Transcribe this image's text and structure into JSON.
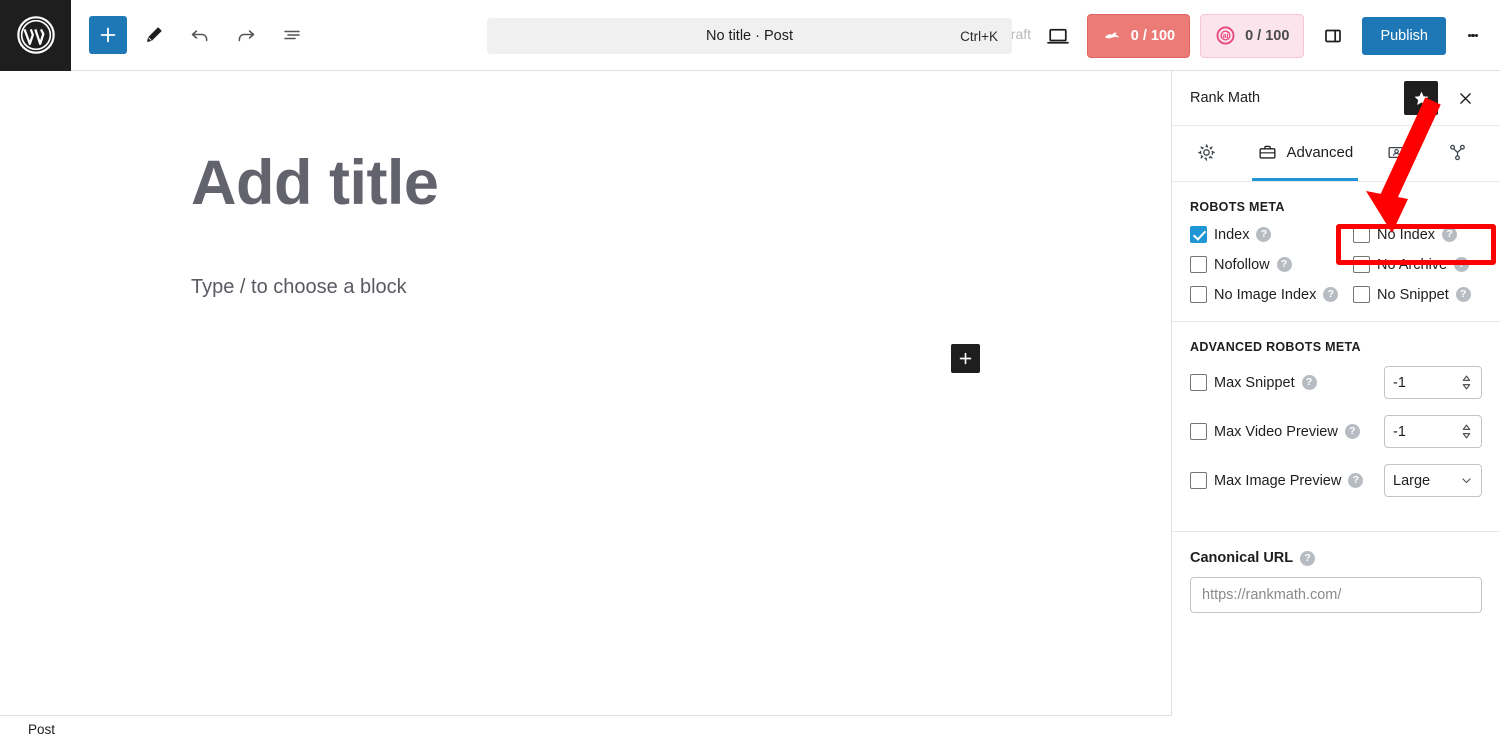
{
  "toolbar": {
    "wp_logo": "wordpress-logo",
    "add_block_label": "+",
    "tools_label": "Tools",
    "undo_label": "Undo",
    "redo_label": "Redo",
    "outline_label": "Document Overview",
    "command_title": "No title · Post",
    "command_shortcut": "Ctrl+K",
    "save_draft": "draft",
    "preview_label": "Preview",
    "seo_score": "0 / 100",
    "ai_score": "0 / 100",
    "sidebar_toggle_label": "Settings",
    "publish_label": "Publish",
    "options_label": "Options"
  },
  "editor": {
    "title_placeholder": "Add title",
    "block_placeholder": "Type / to choose a block",
    "add_block_inline": "+"
  },
  "statusbar": {
    "post_label": "Post"
  },
  "rank_math": {
    "title": "Rank Math",
    "star_label": "Favorite",
    "close_label": "Close",
    "tabs": [
      {
        "label": "",
        "icon": "gear-icon",
        "active": false
      },
      {
        "label": "Advanced",
        "icon": "briefcase-icon",
        "active": true
      },
      {
        "label": "",
        "icon": "social-image-icon",
        "active": false
      },
      {
        "label": "",
        "icon": "schema-icon",
        "active": false
      }
    ],
    "robots_meta": {
      "title": "ROBOTS META",
      "options": [
        {
          "label": "Index",
          "checked": true
        },
        {
          "label": "No Index",
          "checked": false
        },
        {
          "label": "Nofollow",
          "checked": false
        },
        {
          "label": "No Archive",
          "checked": false
        },
        {
          "label": "No Image Index",
          "checked": false
        },
        {
          "label": "No Snippet",
          "checked": false
        }
      ]
    },
    "advanced_robots_meta": {
      "title": "ADVANCED ROBOTS META",
      "rows": [
        {
          "label": "Max Snippet",
          "checked": false,
          "value": "-1",
          "control": "number"
        },
        {
          "label": "Max Video Preview",
          "checked": false,
          "value": "-1",
          "control": "number"
        },
        {
          "label": "Max Image Preview",
          "checked": false,
          "value": "Large",
          "control": "select"
        }
      ]
    },
    "canonical": {
      "label": "Canonical URL",
      "placeholder": "https://rankmath.com/",
      "value": ""
    },
    "help_glyph": "?"
  },
  "annotations": {
    "highlight_target": "No Index",
    "arrow_color": "#ff0000",
    "box_color": "#ff0000"
  },
  "colors": {
    "wp_black": "#1e1e1e",
    "accent_blue": "#1e78b5",
    "tab_blue": "#2196d4",
    "seo_red": "#ec7a77",
    "ai_pink": "#fce4ec",
    "title_gray": "#63636e"
  }
}
